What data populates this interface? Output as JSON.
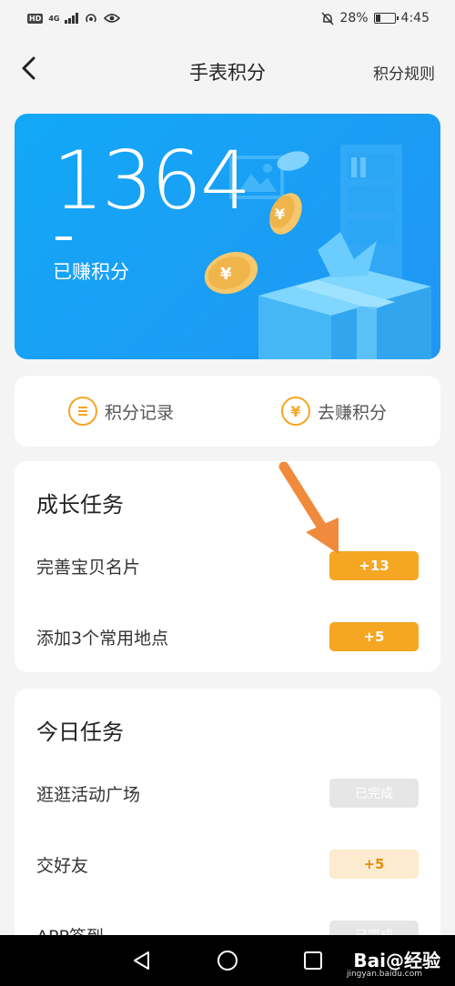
{
  "status_bar": {
    "badge": "HD",
    "network": "4G",
    "battery": "28%",
    "battery_level": 0.28,
    "time": "4:45"
  },
  "nav": {
    "title": "手表积分",
    "rules_label": "积分规则"
  },
  "hero": {
    "points": "1364",
    "label": "已赚积分"
  },
  "quick_actions": [
    {
      "icon": "list-icon",
      "label": "积分记录"
    },
    {
      "icon": "yen-icon",
      "label": "去赚积分"
    }
  ],
  "growth_tasks": {
    "title": "成长任务",
    "items": [
      {
        "name": "完善宝贝名片",
        "action": "+13"
      },
      {
        "name": "添加3个常用地点",
        "action": "+5"
      }
    ]
  },
  "daily_tasks": {
    "title": "今日任务",
    "items": [
      {
        "name": "逛逛活动广场",
        "action": "已完成"
      },
      {
        "name": "交好友",
        "action": "+5"
      },
      {
        "name": "APP签到",
        "action": "已完成"
      }
    ]
  },
  "watermark": {
    "brand": "Bai@经验",
    "url": "jingyan.baidu.com"
  },
  "colors": {
    "accent": "#f5a623",
    "hero_blue": "#12a8f7"
  }
}
